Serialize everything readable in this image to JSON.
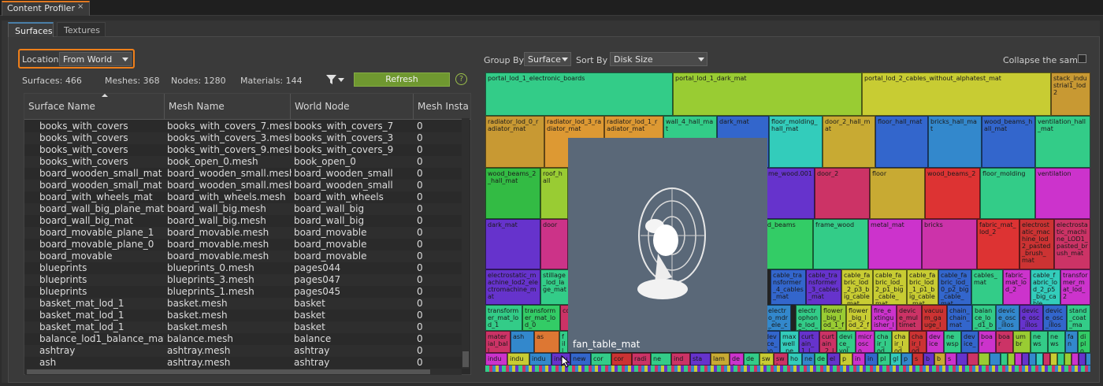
{
  "window": {
    "tab_title": "Content Profiler",
    "close_glyph": "×"
  },
  "tabs": [
    {
      "label": "Surfaces",
      "active": true
    },
    {
      "label": "Textures",
      "active": false
    }
  ],
  "location": {
    "label": "Location",
    "value": "From World"
  },
  "stats": {
    "surfaces": "Surfaces: 466",
    "meshes": "Meshes: 368",
    "nodes": "Nodes: 1280",
    "materials": "Materials: 144"
  },
  "toolbar": {
    "filter_icon": "filter-icon",
    "refresh_label": "Refresh",
    "help_glyph": "?"
  },
  "table": {
    "columns": [
      "Surface Name",
      "Mesh Name",
      "World Node",
      "Mesh Insta"
    ],
    "rows": [
      [
        "books_with_covers",
        "books_with_covers_7.mesh",
        "books_with_covers_7",
        "0"
      ],
      [
        "books_with_covers",
        "books_with_covers_3.mesh",
        "books_with_covers_3",
        "0"
      ],
      [
        "books_with_covers",
        "books_with_covers_9.mesh",
        "books_with_covers_9",
        "0"
      ],
      [
        "books_with_covers",
        "book_open_0.mesh",
        "book_open_0",
        "0"
      ],
      [
        "board_wooden_small_mat",
        "board_wooden_small.mesh",
        "board_wooden_small",
        "0"
      ],
      [
        "board_wooden_small_mat",
        "board_wooden_small.mesh",
        "board_wooden_small",
        "0"
      ],
      [
        "board_with_wheels_mat",
        "board_with_wheels.mesh",
        "board_with_wheels",
        "0"
      ],
      [
        "board_wall_big_plane_mat",
        "board_wall_big.mesh",
        "board_wall_big",
        "0"
      ],
      [
        "board_wall_big_mat",
        "board_wall_big.mesh",
        "board_wall_big",
        "0"
      ],
      [
        "board_movable_plane_1",
        "board_movable.mesh",
        "board_movable",
        "0"
      ],
      [
        "board_movable_plane_0",
        "board_movable.mesh",
        "board_movable",
        "0"
      ],
      [
        "board_movable",
        "board_movable.mesh",
        "board_movable",
        "0"
      ],
      [
        "blueprints",
        "blueprints_0.mesh",
        "pages044",
        "0"
      ],
      [
        "blueprints",
        "blueprints_3.mesh",
        "pages047",
        "0"
      ],
      [
        "blueprints",
        "blueprints_1.mesh",
        "pages045",
        "0"
      ],
      [
        "basket_mat_lod_1",
        "basket.mesh",
        "basket",
        "0"
      ],
      [
        "basket_mat_lod_1",
        "basket.mesh",
        "basket",
        "0"
      ],
      [
        "basket_mat_lod_1",
        "basket.mesh",
        "basket",
        "0"
      ],
      [
        "balance_lod1_balance_mat",
        "balance.mesh",
        "balance",
        "0"
      ],
      [
        "ashtray",
        "ashtray.mesh",
        "ashtray",
        "0"
      ],
      [
        "ash",
        "ashtray.mesh",
        "ashtray",
        "0"
      ]
    ]
  },
  "right_toolbar": {
    "group_by_label": "Group By",
    "group_by_value": "Surface",
    "sort_by_label": "Sort By",
    "sort_by_value": "Disk Size",
    "collapse_label": "Collapse the same"
  },
  "treemap": {
    "blocks": [
      {
        "label": "portal_lod_1_electronic_boards",
        "color": "#33cc88"
      },
      {
        "label": "portal_lod_1_dark_mat",
        "color": "#99cc33"
      },
      {
        "label": "portal_lod_2_cables_without_alphatest_mat",
        "color": "#c8cc33"
      },
      {
        "label": "stack_industrial1_lod2",
        "color": "#c89933"
      },
      {
        "label": "radiator_lod_0_radiator_mat",
        "color": "#c89933"
      },
      {
        "label": "radiator_lod_3_radiator_mat",
        "color": "#dd9933"
      },
      {
        "label": "radiator_lod_1_radiator_mat",
        "color": "#dd9933"
      },
      {
        "label": "wall_4_hall_mat",
        "color": "#33cc88"
      },
      {
        "label": "dark_mat",
        "color": "#3366cc"
      },
      {
        "label": "floor_molding_hall_mat",
        "color": "#33ccbb"
      },
      {
        "label": "door_2_hall_mat",
        "color": "#c8aa33"
      },
      {
        "label": "floor_hall_mat",
        "color": "#3366cc"
      },
      {
        "label": "bricks_hall_mat",
        "color": "#3388cc"
      },
      {
        "label": "wood_beams_hall_mat",
        "color": "#3366cc"
      },
      {
        "label": "ventilation_hall_mat",
        "color": "#33cc88"
      },
      {
        "label": "wood_beams_2_hall_mat",
        "color": "#33bb44"
      },
      {
        "label": "roof_hall",
        "color": "#99cc33"
      },
      {
        "label": "me_wood.001",
        "color": "#6633cc"
      },
      {
        "label": "door_2",
        "color": "#cc3366"
      },
      {
        "label": "floor",
        "color": "#c8aa33"
      },
      {
        "label": "wood_beams_2",
        "color": "#dd3333"
      },
      {
        "label": "floor_molding",
        "color": "#33cc88"
      },
      {
        "label": "ventilation",
        "color": "#cc33cc"
      },
      {
        "label": "dark_mat",
        "color": "#6633cc"
      },
      {
        "label": "door",
        "color": "#cc3388"
      },
      {
        "label": "od_beams",
        "color": "#33cc66"
      },
      {
        "label": "frame_wood",
        "color": "#33cc88"
      },
      {
        "label": "metal_mat",
        "color": "#cc33cc"
      },
      {
        "label": "bricks",
        "color": "#cc33aa"
      },
      {
        "label": "fabric_mat_lod_2",
        "color": "#dd3333"
      },
      {
        "label": "electrostatic_machine_lod2_pasted_brush_mat",
        "color": "#cc3333"
      },
      {
        "label": "electrostatic_machine_LOD1_pasted_brush_mat",
        "color": "#cc3366"
      },
      {
        "label": "electrostatic_machine_lod2_electromachine_mat",
        "color": "#6633cc"
      },
      {
        "label": "stillage_lod_lage_mat",
        "color": "#33cc88"
      },
      {
        "label": "cable_transformer_4_cables_mat",
        "color": "#3366cc"
      },
      {
        "label": "cable_transformer_3_cables_mat",
        "color": "#6633cc"
      },
      {
        "label": "cable_fabric_lod_2_p3_big_cable_mat",
        "color": "#c8cc33"
      },
      {
        "label": "cable_fabric_lod_2_p1_big_cable_mat",
        "color": "#c8cc33"
      },
      {
        "label": "cable_fabric_lod_1_p1_big_cable_mat",
        "color": "#c8cc33"
      },
      {
        "label": "cable_fabric_lod_0_p2_big_cable_mat",
        "color": "#3366cc"
      },
      {
        "label": "cables_mat",
        "color": "#33cc88"
      },
      {
        "label": "fabric_mat_lod_2",
        "color": "#cc33cc"
      },
      {
        "label": "cable_fabric_lod_2_p5_big_cable",
        "color": "#33ccbb"
      },
      {
        "label": "transformer_mat_lod_2",
        "color": "#cc33cc"
      },
      {
        "label": "transformer_mat_lod_1",
        "color": "#33cc88"
      },
      {
        "label": "transformer_mat_lod_0",
        "color": "#33cc66"
      },
      {
        "label": "co",
        "color": "#cc3366"
      },
      {
        "label": "electro_mdr_ele_ctromet",
        "color": "#3388cc"
      },
      {
        "label": "electrophone_lod_2_telep",
        "color": "#33cc88"
      },
      {
        "label": "flower_big_lod_1_flow",
        "color": "#99cc33"
      },
      {
        "label": "flower_big_lod_2_flow",
        "color": "#c8cc33"
      },
      {
        "label": "fire_extinguisher_l",
        "color": "#cc33cc"
      },
      {
        "label": "device_multimete",
        "color": "#cc3366"
      },
      {
        "label": "vacuum_gauge_l",
        "color": "#cc3333"
      },
      {
        "label": "chain_chain_mat",
        "color": "#3366cc"
      },
      {
        "label": "balance_lo_d1_ba",
        "color": "#33cc88"
      },
      {
        "label": "device_osc_illosc",
        "color": "#3388cc"
      },
      {
        "label": "device_osc_illosc",
        "color": "#6633cc"
      },
      {
        "label": "device_osc_illosc",
        "color": "#3366cc"
      },
      {
        "label": "stand_coat_ma",
        "color": "#33cc88"
      },
      {
        "label": "material_ball_",
        "color": "#cc3366"
      },
      {
        "label": "ash",
        "color": "#3388cc"
      },
      {
        "label": "as",
        "color": "#dd7733"
      },
      {
        "label": "fill_a",
        "color": "#33cc88"
      },
      {
        "label": "device_po",
        "color": "#3366cc"
      },
      {
        "label": "maxwell_pe",
        "color": "#33ccbb"
      },
      {
        "label": "curtain_1_l",
        "color": "#6633cc"
      },
      {
        "label": "curtain_2_l",
        "color": "#cc3366"
      },
      {
        "label": "device_vol",
        "color": "#33cc88"
      },
      {
        "label": "microsco",
        "color": "#cc33cc"
      },
      {
        "label": "chair_lod",
        "color": "#33cc88"
      },
      {
        "label": "chair_lod",
        "color": "#c8cc33"
      },
      {
        "label": "chair_lod",
        "color": "#cc3333"
      },
      {
        "label": "device",
        "color": "#cc33cc"
      },
      {
        "label": "newsp",
        "color": "#33cc88"
      },
      {
        "label": "device_",
        "color": "#3366cc"
      },
      {
        "label": "boar",
        "color": "#cc33cc"
      },
      {
        "label": "boar",
        "color": "#cc3366"
      },
      {
        "label": "umbr",
        "color": "#99cc33"
      },
      {
        "label": "news",
        "color": "#33cc88"
      },
      {
        "label": "news",
        "color": "#33cc88"
      },
      {
        "label": "fan",
        "color": "#3388cc"
      },
      {
        "label": "diplo",
        "color": "#33cc66"
      },
      {
        "label": "indu",
        "color": "#cc33cc"
      },
      {
        "label": "indu",
        "color": "#c8cc33"
      },
      {
        "label": "indu",
        "color": "#3388cc"
      },
      {
        "label": "indu",
        "color": "#6633cc"
      },
      {
        "label": "new",
        "color": "#3366cc"
      },
      {
        "label": "cor",
        "color": "#33cc88"
      },
      {
        "label": "cor",
        "color": "#cc3333"
      },
      {
        "label": "radi",
        "color": "#cc3366"
      },
      {
        "label": "ne",
        "color": "#33cc88"
      },
      {
        "label": "ind",
        "color": "#cc3366"
      },
      {
        "label": "sta",
        "color": "#6633cc"
      },
      {
        "label": "lam",
        "color": "#c8aa33"
      },
      {
        "label": "des",
        "color": "#cc33cc"
      },
      {
        "label": "des",
        "color": "#33cc88"
      },
      {
        "label": "swi",
        "color": "#c8cc33"
      },
      {
        "label": "swi",
        "color": "#cc3366"
      },
      {
        "label": "ho",
        "color": "#33ccbb"
      },
      {
        "label": "ne",
        "color": "#3388cc"
      },
      {
        "label": "de",
        "color": "#33cc88"
      },
      {
        "label": "el",
        "color": "#6633cc"
      },
      {
        "label": "p",
        "color": "#c8cc33"
      },
      {
        "label": "in",
        "color": "#cc33cc"
      },
      {
        "label": "in",
        "color": "#3366cc"
      },
      {
        "label": "pl",
        "color": "#33cc88"
      },
      {
        "label": "gl",
        "color": "#33ccbb"
      },
      {
        "label": "p",
        "color": "#3388cc"
      },
      {
        "label": "s",
        "color": "#cc3333"
      },
      {
        "label": "b",
        "color": "#6633cc"
      },
      {
        "label": "b",
        "color": "#c8aa33"
      },
      {
        "label": "s",
        "color": "#cc33cc"
      }
    ]
  },
  "preview": {
    "label": "fan_table_mat"
  }
}
